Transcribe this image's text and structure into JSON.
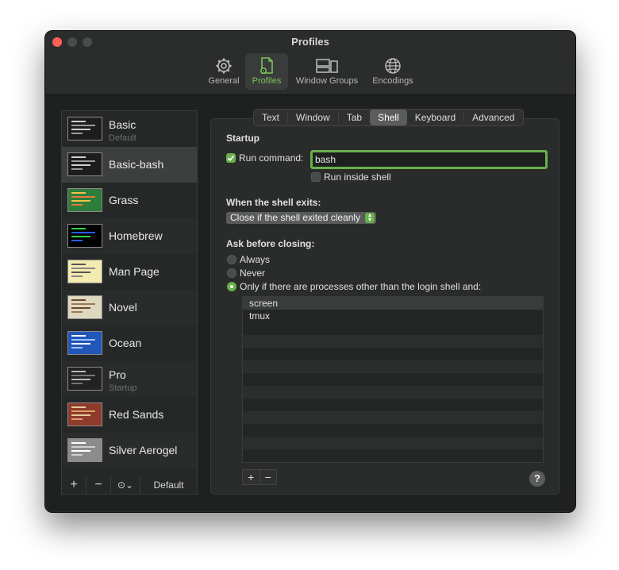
{
  "window": {
    "title": "Profiles"
  },
  "toolbar": {
    "items": [
      {
        "label": "General",
        "icon": "gear-icon"
      },
      {
        "label": "Profiles",
        "icon": "profiles-icon",
        "active": true
      },
      {
        "label": "Window Groups",
        "icon": "window-groups-icon"
      },
      {
        "label": "Encodings",
        "icon": "globe-icon"
      }
    ]
  },
  "sidebar": {
    "profiles": [
      {
        "name": "Basic",
        "subtitle": "Default",
        "thumb_bg": "#1d1d1d",
        "thumb_fg": "#cfcfcf"
      },
      {
        "name": "Basic-bash",
        "subtitle": "",
        "thumb_bg": "#1d1d1d",
        "thumb_fg": "#cfcfcf"
      },
      {
        "name": "Grass",
        "subtitle": "",
        "thumb_bg": "#2e7d3a",
        "thumb_fg": "#f2c14e"
      },
      {
        "name": "Homebrew",
        "subtitle": "",
        "thumb_bg": "#000000",
        "thumb_fg": "#2fd148"
      },
      {
        "name": "Man Page",
        "subtitle": "",
        "thumb_bg": "#f4ebb0",
        "thumb_fg": "#555555"
      },
      {
        "name": "Novel",
        "subtitle": "",
        "thumb_bg": "#dfd8c0",
        "thumb_fg": "#6b4a2a"
      },
      {
        "name": "Ocean",
        "subtitle": "",
        "thumb_bg": "#2256b8",
        "thumb_fg": "#ffffff"
      },
      {
        "name": "Pro",
        "subtitle": "Startup",
        "thumb_bg": "#222222",
        "thumb_fg": "#bbbbbb"
      },
      {
        "name": "Red Sands",
        "subtitle": "",
        "thumb_bg": "#8f3b2b",
        "thumb_fg": "#e8c9a0"
      },
      {
        "name": "Silver Aerogel",
        "subtitle": "",
        "thumb_bg": "#8c8c8c",
        "thumb_fg": "#ffffff"
      }
    ],
    "selected": "Basic-bash",
    "tools": {
      "add": "+",
      "remove": "−",
      "more": "⊙⌄",
      "default_label": "Default"
    }
  },
  "tabs": [
    "Text",
    "Window",
    "Tab",
    "Shell",
    "Keyboard",
    "Advanced"
  ],
  "selected_tab": "Shell",
  "shell": {
    "startup_heading": "Startup",
    "run_command_label": "Run command:",
    "run_command_checked": true,
    "run_command_value": "bash",
    "run_inside_shell_label": "Run inside shell",
    "run_inside_shell_checked": false,
    "exit_heading": "When the shell exits:",
    "exit_option": "Close if the shell exited cleanly",
    "ask_heading": "Ask before closing:",
    "ask_options": [
      "Always",
      "Never",
      "Only if there are processes other than the login shell and:"
    ],
    "ask_selected": 2,
    "processes": [
      "screen",
      "tmux"
    ],
    "list_add": "+",
    "list_remove": "−",
    "help": "?"
  },
  "colors": {
    "accent": "#6ab04c"
  }
}
